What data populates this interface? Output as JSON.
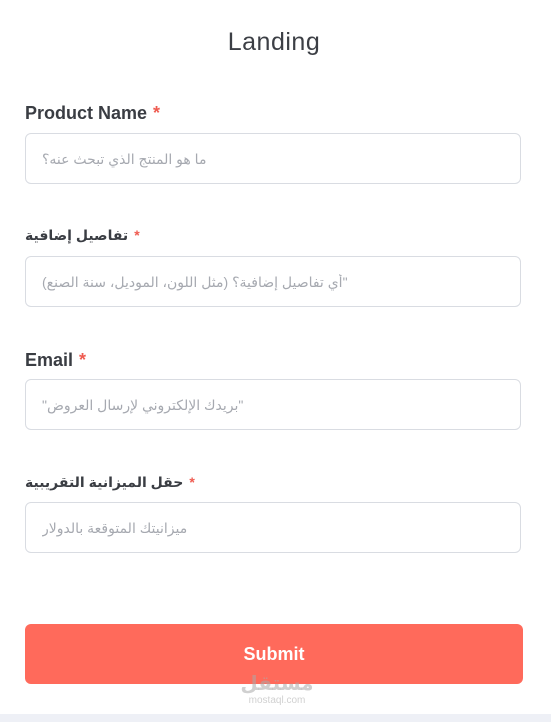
{
  "form": {
    "title": "Landing",
    "required_mark": "*",
    "fields": [
      {
        "label": "Product Name",
        "placeholder": "ما هو المنتج الذي تبحث عنه؟"
      },
      {
        "label": "تفاصيل إضافية",
        "placeholder": "\"أي تفاصيل إضافية؟ (مثل اللون، الموديل، سنة الصنع)"
      },
      {
        "label": "Email",
        "placeholder": "\"بريدك الإلكتروني لإرسال العروض\""
      },
      {
        "label": "حقل الميزانية التقريبية",
        "placeholder": "ميزانيتك المتوقعة بالدولار"
      }
    ],
    "submit_label": "Submit"
  },
  "watermark": {
    "arabic": "مستقل",
    "latin": "mostaql.com"
  },
  "colors": {
    "accent": "#ff6a5b",
    "required": "#ef5b50",
    "border": "#d9dce2"
  }
}
